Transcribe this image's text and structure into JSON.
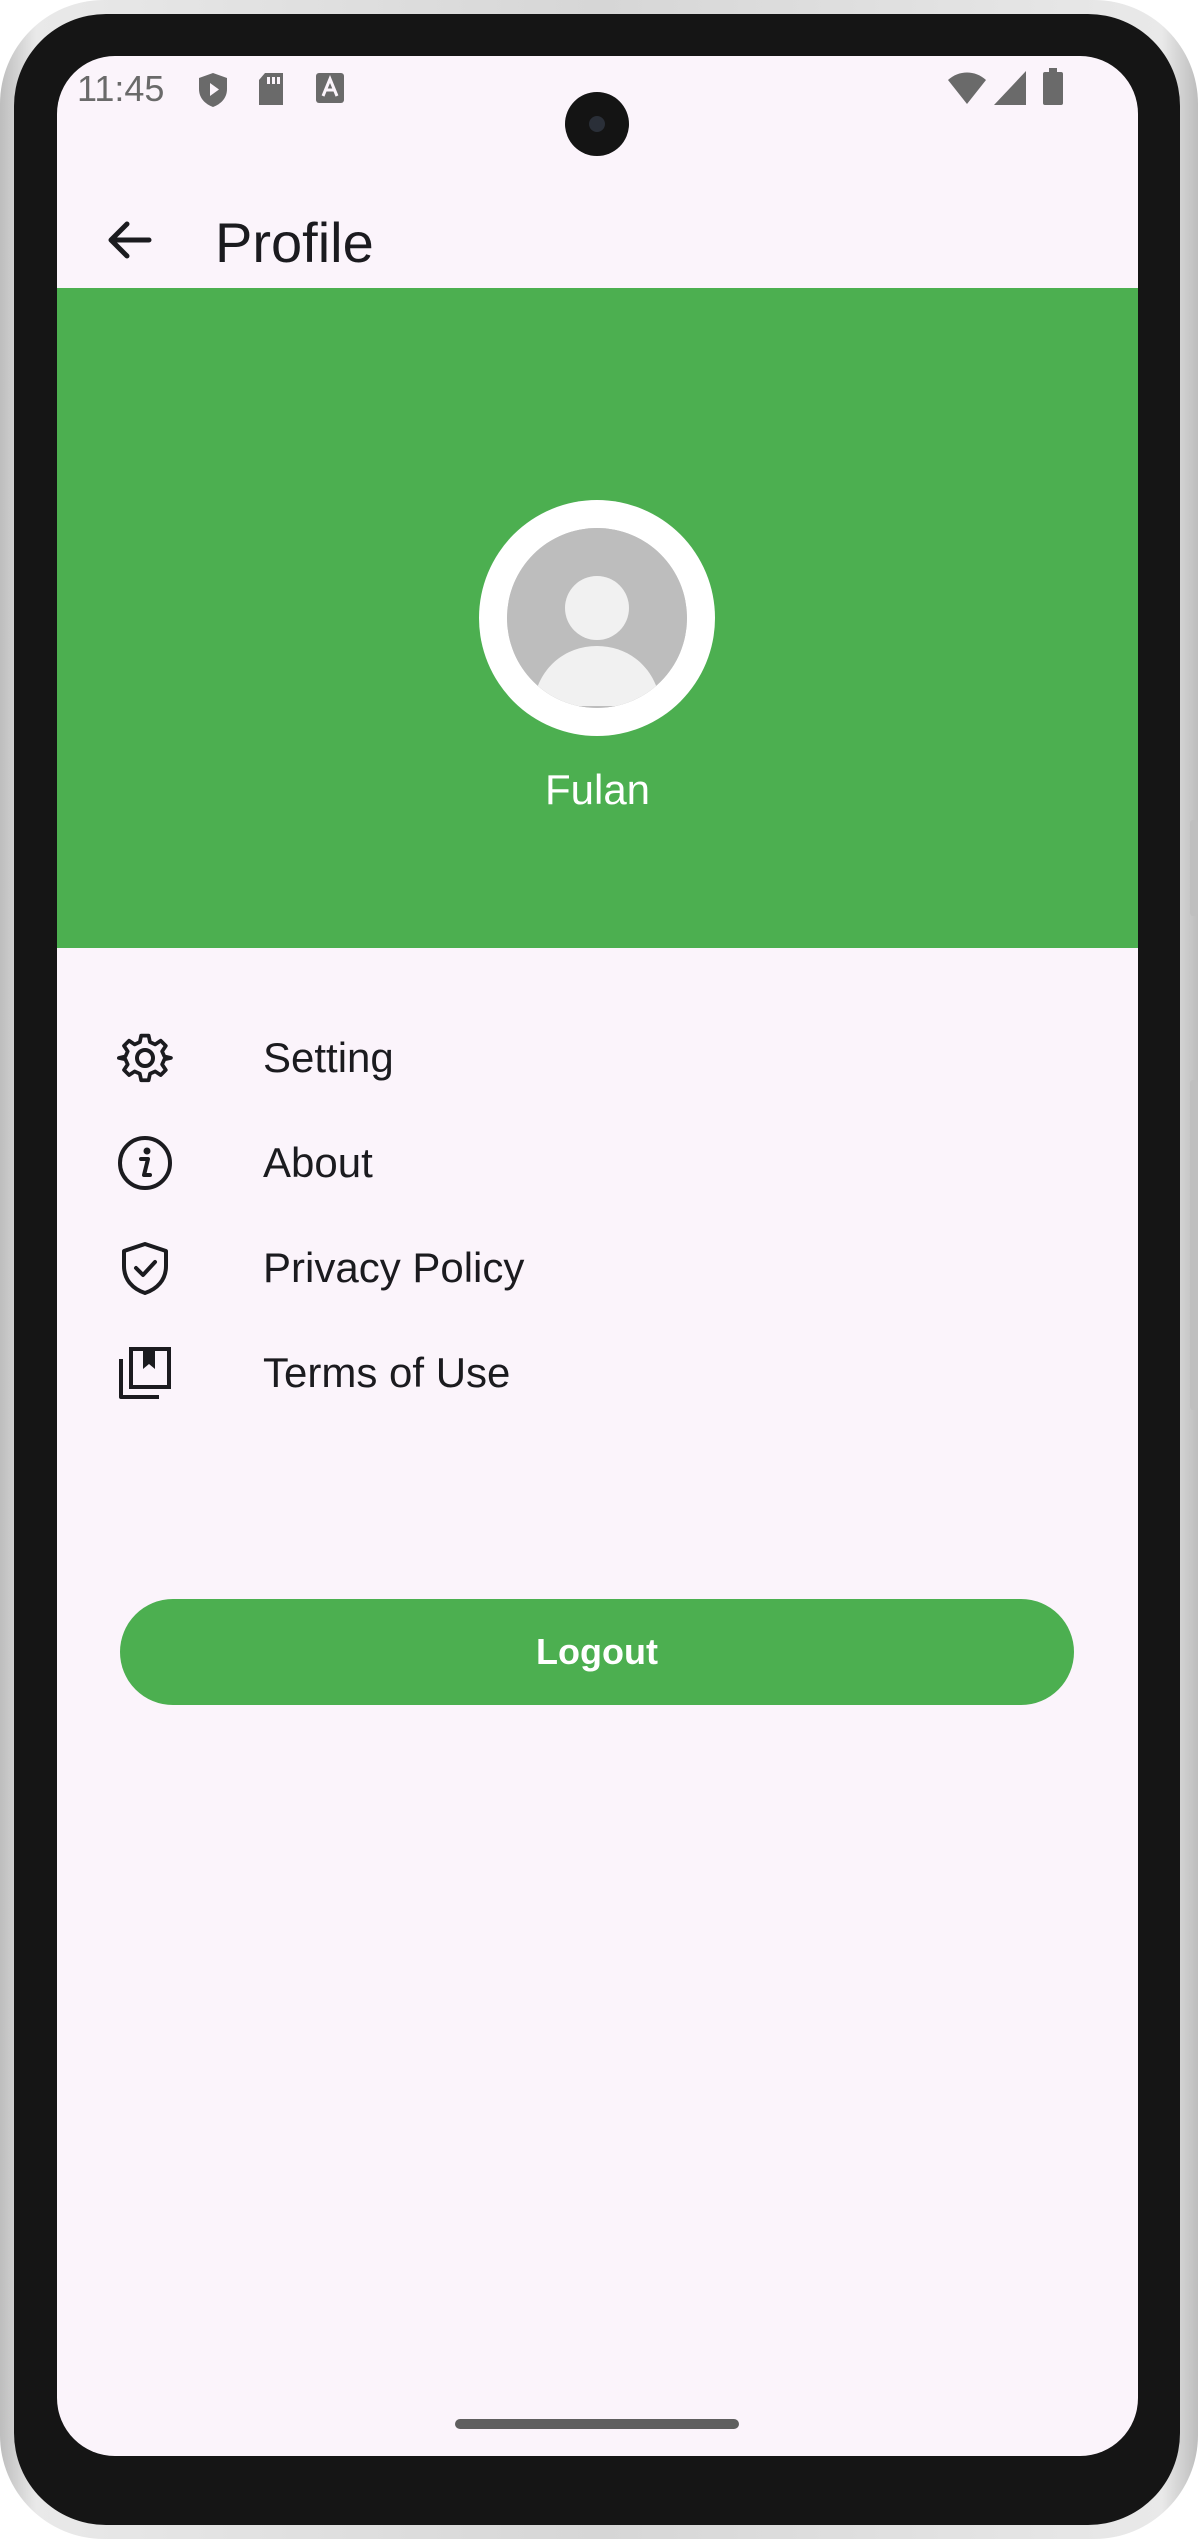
{
  "status_bar": {
    "time": "11:45",
    "left_icons": [
      "shield-play-icon",
      "sd-card-icon",
      "font-a-icon"
    ],
    "right_icons": [
      "wifi-icon",
      "cellular-signal-icon",
      "battery-icon"
    ]
  },
  "app_bar": {
    "title": "Profile",
    "back_icon": "arrow-back-icon"
  },
  "profile": {
    "name": "Fulan",
    "avatar_icon": "default-user-avatar-icon"
  },
  "menu": {
    "items": [
      {
        "label": "Setting",
        "icon": "gear-icon"
      },
      {
        "label": "About",
        "icon": "info-icon"
      },
      {
        "label": "Privacy Policy",
        "icon": "shield-check-icon"
      },
      {
        "label": "Terms of Use",
        "icon": "bookmarks-icon"
      }
    ]
  },
  "logout": {
    "label": "Logout"
  },
  "colors": {
    "accent": "#4caf50",
    "background": "#fbf4fb",
    "text": "#1b1b1f",
    "on_accent": "#ffffff"
  }
}
